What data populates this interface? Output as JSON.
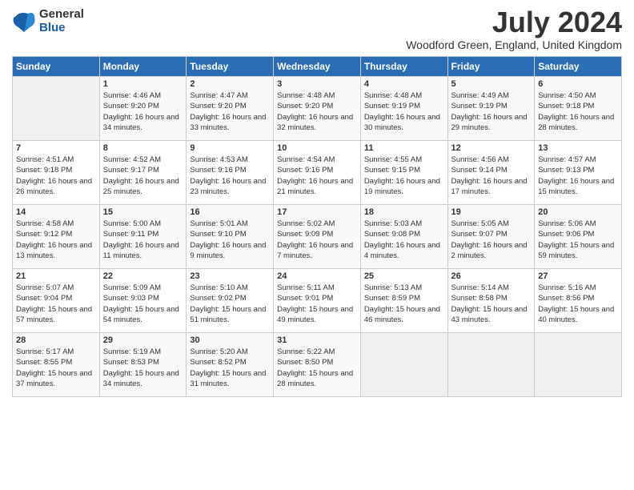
{
  "logo": {
    "general": "General",
    "blue": "Blue"
  },
  "title": "July 2024",
  "location": "Woodford Green, England, United Kingdom",
  "headers": [
    "Sunday",
    "Monday",
    "Tuesday",
    "Wednesday",
    "Thursday",
    "Friday",
    "Saturday"
  ],
  "weeks": [
    [
      {
        "day": "",
        "sunrise": "",
        "sunset": "",
        "daylight": ""
      },
      {
        "day": "1",
        "sunrise": "Sunrise: 4:46 AM",
        "sunset": "Sunset: 9:20 PM",
        "daylight": "Daylight: 16 hours and 34 minutes."
      },
      {
        "day": "2",
        "sunrise": "Sunrise: 4:47 AM",
        "sunset": "Sunset: 9:20 PM",
        "daylight": "Daylight: 16 hours and 33 minutes."
      },
      {
        "day": "3",
        "sunrise": "Sunrise: 4:48 AM",
        "sunset": "Sunset: 9:20 PM",
        "daylight": "Daylight: 16 hours and 32 minutes."
      },
      {
        "day": "4",
        "sunrise": "Sunrise: 4:48 AM",
        "sunset": "Sunset: 9:19 PM",
        "daylight": "Daylight: 16 hours and 30 minutes."
      },
      {
        "day": "5",
        "sunrise": "Sunrise: 4:49 AM",
        "sunset": "Sunset: 9:19 PM",
        "daylight": "Daylight: 16 hours and 29 minutes."
      },
      {
        "day": "6",
        "sunrise": "Sunrise: 4:50 AM",
        "sunset": "Sunset: 9:18 PM",
        "daylight": "Daylight: 16 hours and 28 minutes."
      }
    ],
    [
      {
        "day": "7",
        "sunrise": "Sunrise: 4:51 AM",
        "sunset": "Sunset: 9:18 PM",
        "daylight": "Daylight: 16 hours and 26 minutes."
      },
      {
        "day": "8",
        "sunrise": "Sunrise: 4:52 AM",
        "sunset": "Sunset: 9:17 PM",
        "daylight": "Daylight: 16 hours and 25 minutes."
      },
      {
        "day": "9",
        "sunrise": "Sunrise: 4:53 AM",
        "sunset": "Sunset: 9:16 PM",
        "daylight": "Daylight: 16 hours and 23 minutes."
      },
      {
        "day": "10",
        "sunrise": "Sunrise: 4:54 AM",
        "sunset": "Sunset: 9:16 PM",
        "daylight": "Daylight: 16 hours and 21 minutes."
      },
      {
        "day": "11",
        "sunrise": "Sunrise: 4:55 AM",
        "sunset": "Sunset: 9:15 PM",
        "daylight": "Daylight: 16 hours and 19 minutes."
      },
      {
        "day": "12",
        "sunrise": "Sunrise: 4:56 AM",
        "sunset": "Sunset: 9:14 PM",
        "daylight": "Daylight: 16 hours and 17 minutes."
      },
      {
        "day": "13",
        "sunrise": "Sunrise: 4:57 AM",
        "sunset": "Sunset: 9:13 PM",
        "daylight": "Daylight: 16 hours and 15 minutes."
      }
    ],
    [
      {
        "day": "14",
        "sunrise": "Sunrise: 4:58 AM",
        "sunset": "Sunset: 9:12 PM",
        "daylight": "Daylight: 16 hours and 13 minutes."
      },
      {
        "day": "15",
        "sunrise": "Sunrise: 5:00 AM",
        "sunset": "Sunset: 9:11 PM",
        "daylight": "Daylight: 16 hours and 11 minutes."
      },
      {
        "day": "16",
        "sunrise": "Sunrise: 5:01 AM",
        "sunset": "Sunset: 9:10 PM",
        "daylight": "Daylight: 16 hours and 9 minutes."
      },
      {
        "day": "17",
        "sunrise": "Sunrise: 5:02 AM",
        "sunset": "Sunset: 9:09 PM",
        "daylight": "Daylight: 16 hours and 7 minutes."
      },
      {
        "day": "18",
        "sunrise": "Sunrise: 5:03 AM",
        "sunset": "Sunset: 9:08 PM",
        "daylight": "Daylight: 16 hours and 4 minutes."
      },
      {
        "day": "19",
        "sunrise": "Sunrise: 5:05 AM",
        "sunset": "Sunset: 9:07 PM",
        "daylight": "Daylight: 16 hours and 2 minutes."
      },
      {
        "day": "20",
        "sunrise": "Sunrise: 5:06 AM",
        "sunset": "Sunset: 9:06 PM",
        "daylight": "Daylight: 15 hours and 59 minutes."
      }
    ],
    [
      {
        "day": "21",
        "sunrise": "Sunrise: 5:07 AM",
        "sunset": "Sunset: 9:04 PM",
        "daylight": "Daylight: 15 hours and 57 minutes."
      },
      {
        "day": "22",
        "sunrise": "Sunrise: 5:09 AM",
        "sunset": "Sunset: 9:03 PM",
        "daylight": "Daylight: 15 hours and 54 minutes."
      },
      {
        "day": "23",
        "sunrise": "Sunrise: 5:10 AM",
        "sunset": "Sunset: 9:02 PM",
        "daylight": "Daylight: 15 hours and 51 minutes."
      },
      {
        "day": "24",
        "sunrise": "Sunrise: 5:11 AM",
        "sunset": "Sunset: 9:01 PM",
        "daylight": "Daylight: 15 hours and 49 minutes."
      },
      {
        "day": "25",
        "sunrise": "Sunrise: 5:13 AM",
        "sunset": "Sunset: 8:59 PM",
        "daylight": "Daylight: 15 hours and 46 minutes."
      },
      {
        "day": "26",
        "sunrise": "Sunrise: 5:14 AM",
        "sunset": "Sunset: 8:58 PM",
        "daylight": "Daylight: 15 hours and 43 minutes."
      },
      {
        "day": "27",
        "sunrise": "Sunrise: 5:16 AM",
        "sunset": "Sunset: 8:56 PM",
        "daylight": "Daylight: 15 hours and 40 minutes."
      }
    ],
    [
      {
        "day": "28",
        "sunrise": "Sunrise: 5:17 AM",
        "sunset": "Sunset: 8:55 PM",
        "daylight": "Daylight: 15 hours and 37 minutes."
      },
      {
        "day": "29",
        "sunrise": "Sunrise: 5:19 AM",
        "sunset": "Sunset: 8:53 PM",
        "daylight": "Daylight: 15 hours and 34 minutes."
      },
      {
        "day": "30",
        "sunrise": "Sunrise: 5:20 AM",
        "sunset": "Sunset: 8:52 PM",
        "daylight": "Daylight: 15 hours and 31 minutes."
      },
      {
        "day": "31",
        "sunrise": "Sunrise: 5:22 AM",
        "sunset": "Sunset: 8:50 PM",
        "daylight": "Daylight: 15 hours and 28 minutes."
      },
      {
        "day": "",
        "sunrise": "",
        "sunset": "",
        "daylight": ""
      },
      {
        "day": "",
        "sunrise": "",
        "sunset": "",
        "daylight": ""
      },
      {
        "day": "",
        "sunrise": "",
        "sunset": "",
        "daylight": ""
      }
    ]
  ]
}
